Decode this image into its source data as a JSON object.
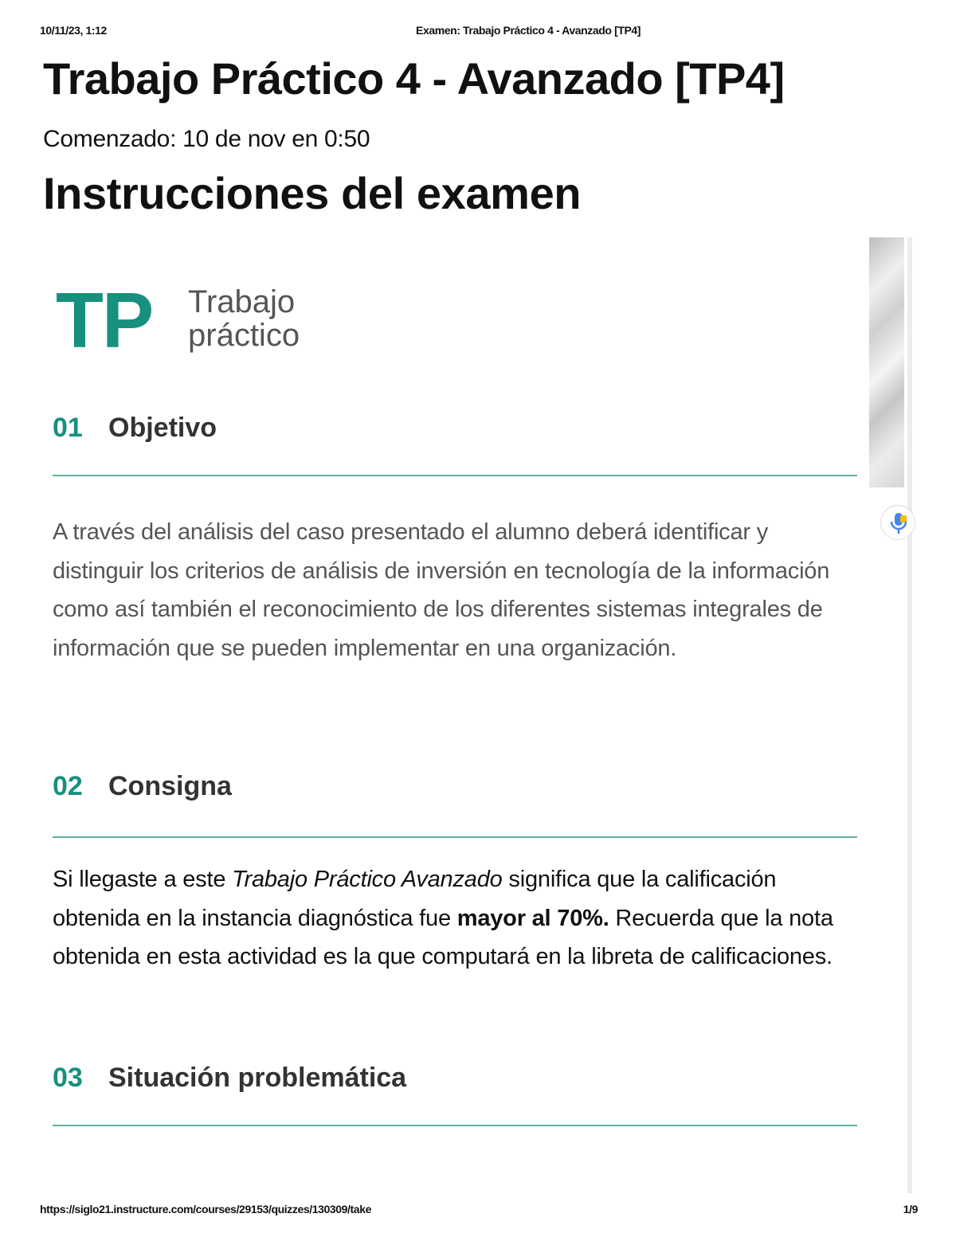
{
  "print_header": {
    "date": "10/11/23, 1:12",
    "doc_title": "Examen: Trabajo Práctico 4 - Avanzado [TP4]"
  },
  "page": {
    "title": "Trabajo Práctico 4 - Avanzado [TP4]",
    "started": "Comenzado: 10 de nov en 0:50",
    "instructions_heading": "Instrucciones del examen"
  },
  "logo": {
    "mark": "TP",
    "line1": "Trabajo",
    "line2": "práctico"
  },
  "sections": [
    {
      "number": "01",
      "title": "Objetivo",
      "body": "A través del análisis del caso presentado el alumno deberá identificar y distinguir los criterios de análisis de inversión en tecnología de la información como así también el reconocimiento de los diferentes sistemas integrales de información que se pueden implementar en una organización."
    },
    {
      "number": "02",
      "title": "Consigna",
      "body": {
        "part1": "Si llegaste a este ",
        "italic": "Trabajo Práctico Avanzado",
        "part2": " significa que la calificación obtenida en la instancia diagnóstica fue ",
        "bold": "mayor al 70%.",
        "part3": " Recuerda que la nota obtenida en esta actividad es la que computará en la libreta de calificaciones."
      }
    },
    {
      "number": "03",
      "title": "Situación problemática"
    }
  ],
  "print_footer": {
    "url": "https://siglo21.instructure.com/courses/29153/quizzes/130309/take",
    "page": "1/9"
  },
  "colors": {
    "accent": "#17907e",
    "rule": "#5db0a3",
    "body_grey": "#555555"
  },
  "icons": {
    "voice": "microphone-icon"
  }
}
